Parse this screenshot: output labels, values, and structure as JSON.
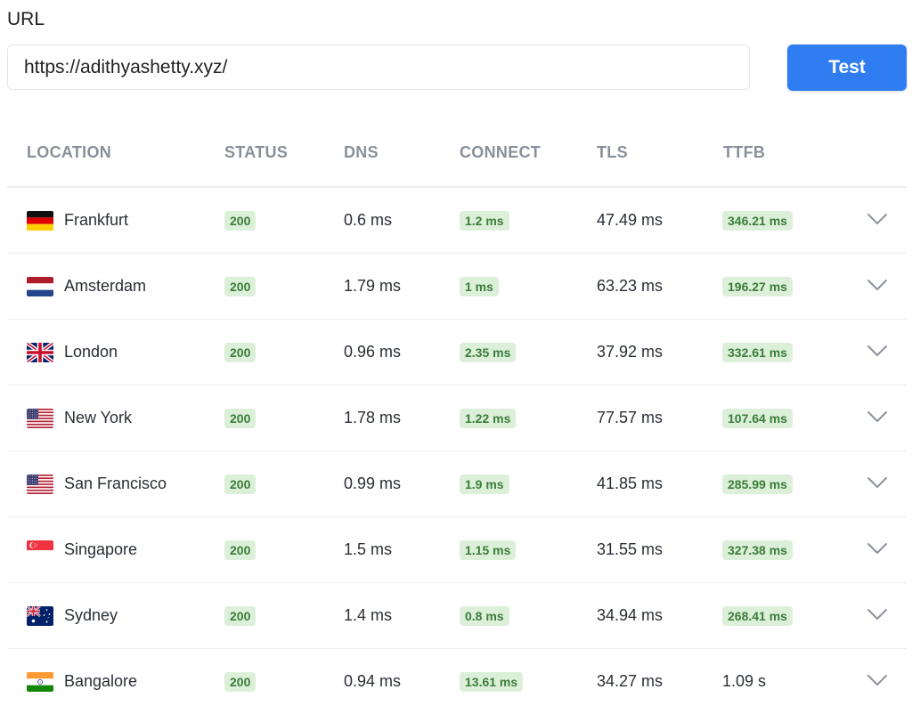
{
  "url_label": "URL",
  "url_value": "https://adithyashetty.xyz/",
  "test_button": "Test",
  "columns": [
    "LOCATION",
    "STATUS",
    "DNS",
    "CONNECT",
    "TLS",
    "TTFB"
  ],
  "rows": [
    {
      "flag": "germany-flag",
      "location": "Frankfurt",
      "status": "200",
      "dns": "0.6 ms",
      "connect": "1.2 ms",
      "tls": "47.49 ms",
      "ttfb": "346.21 ms",
      "ttfb_badge": true
    },
    {
      "flag": "netherlands-flag",
      "location": "Amsterdam",
      "status": "200",
      "dns": "1.79 ms",
      "connect": "1 ms",
      "tls": "63.23 ms",
      "ttfb": "196.27 ms",
      "ttfb_badge": true
    },
    {
      "flag": "uk-flag",
      "location": "London",
      "status": "200",
      "dns": "0.96 ms",
      "connect": "2.35 ms",
      "tls": "37.92 ms",
      "ttfb": "332.61 ms",
      "ttfb_badge": true
    },
    {
      "flag": "us-flag",
      "location": "New York",
      "status": "200",
      "dns": "1.78 ms",
      "connect": "1.22 ms",
      "tls": "77.57 ms",
      "ttfb": "107.64 ms",
      "ttfb_badge": true
    },
    {
      "flag": "us-flag",
      "location": "San Francisco",
      "status": "200",
      "dns": "0.99 ms",
      "connect": "1.9 ms",
      "tls": "41.85 ms",
      "ttfb": "285.99 ms",
      "ttfb_badge": true
    },
    {
      "flag": "singapore-flag",
      "location": "Singapore",
      "status": "200",
      "dns": "1.5 ms",
      "connect": "1.15 ms",
      "tls": "31.55 ms",
      "ttfb": "327.38 ms",
      "ttfb_badge": true
    },
    {
      "flag": "australia-flag",
      "location": "Sydney",
      "status": "200",
      "dns": "1.4 ms",
      "connect": "0.8 ms",
      "tls": "34.94 ms",
      "ttfb": "268.41 ms",
      "ttfb_badge": true
    },
    {
      "flag": "india-flag",
      "location": "Bangalore",
      "status": "200",
      "dns": "0.94 ms",
      "connect": "13.61 ms",
      "tls": "34.27 ms",
      "ttfb": "1.09 s",
      "ttfb_badge": false
    }
  ],
  "colors": {
    "accent": "#2f7df0",
    "badge_bg": "#dcefd9",
    "badge_text": "#3b7d3a",
    "header_text": "#8a9099"
  }
}
